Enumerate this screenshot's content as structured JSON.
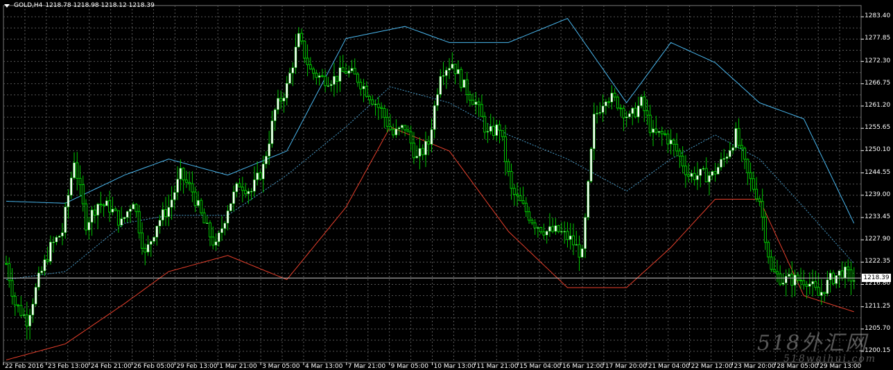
{
  "header": {
    "symbol": "GOLD,H4",
    "ohlc": "1218.78 1218.98 1218.12 1218.39"
  },
  "current_price": "1218.39",
  "price_axis": [
    "1283.40",
    "1277.85",
    "1272.30",
    "1266.75",
    "1261.20",
    "1255.65",
    "1250.10",
    "1244.55",
    "1239.00",
    "1233.45",
    "1227.90",
    "1222.35",
    "1216.80",
    "1211.25",
    "1205.70",
    "1200.15"
  ],
  "time_axis": [
    "22 Feb 2016",
    "23 Feb 13:00",
    "24 Feb 21:00",
    "26 Feb 05:00",
    "29 Feb 13:00",
    "1 Mar 21:00",
    "3 Mar 05:00",
    "4 Mar 13:00",
    "7 Mar 21:00",
    "9 Mar 05:00",
    "10 Mar 13:00",
    "11 Mar 21:00",
    "15 Mar 04:00",
    "16 Mar 12:00",
    "17 Mar 20:00",
    "21 Mar 04:00",
    "22 Mar 12:00",
    "23 Mar 20:00",
    "28 Mar 05:00",
    "29 Mar 13:00"
  ],
  "watermark": {
    "line1": "518外汇网",
    "line2": "518waihui.com"
  },
  "colors": {
    "background": "#000000",
    "grid": "#5a5a5a",
    "bull": "#ffffff",
    "wick": "#00c800",
    "upper_band": "#4ab8f0",
    "lower_band": "#e8402c",
    "middle_band": "#4aa0d0"
  },
  "chart_data": {
    "type": "candlestick",
    "ylim": [
      1197.4,
      1286.2
    ],
    "indicator": "Bollinger Bands",
    "close_anchors": [
      [
        0,
        1222
      ],
      [
        3,
        1212
      ],
      [
        7,
        1208
      ],
      [
        11,
        1218
      ],
      [
        15,
        1226
      ],
      [
        19,
        1230
      ],
      [
        23,
        1248
      ],
      [
        27,
        1232
      ],
      [
        31,
        1237
      ],
      [
        35,
        1236
      ],
      [
        39,
        1232
      ],
      [
        43,
        1238
      ],
      [
        47,
        1224
      ],
      [
        51,
        1232
      ],
      [
        55,
        1236
      ],
      [
        59,
        1244
      ],
      [
        63,
        1240
      ],
      [
        67,
        1232
      ],
      [
        71,
        1226
      ],
      [
        75,
        1236
      ],
      [
        79,
        1242
      ],
      [
        83,
        1240
      ],
      [
        87,
        1246
      ],
      [
        91,
        1260
      ],
      [
        95,
        1266
      ],
      [
        99,
        1278
      ],
      [
        103,
        1270
      ],
      [
        107,
        1268
      ],
      [
        111,
        1268
      ],
      [
        115,
        1270
      ],
      [
        119,
        1268
      ],
      [
        123,
        1264
      ],
      [
        127,
        1260
      ],
      [
        131,
        1254
      ],
      [
        135,
        1256
      ],
      [
        139,
        1248
      ],
      [
        143,
        1252
      ],
      [
        147,
        1270
      ],
      [
        151,
        1272
      ],
      [
        155,
        1266
      ],
      [
        159,
        1262
      ],
      [
        163,
        1254
      ],
      [
        167,
        1256
      ],
      [
        171,
        1240
      ],
      [
        175,
        1236
      ],
      [
        179,
        1232
      ],
      [
        183,
        1230
      ],
      [
        187,
        1230
      ],
      [
        191,
        1228
      ],
      [
        195,
        1224
      ],
      [
        199,
        1258
      ],
      [
        203,
        1264
      ],
      [
        207,
        1262
      ],
      [
        211,
        1258
      ],
      [
        215,
        1262
      ],
      [
        219,
        1254
      ],
      [
        223,
        1254
      ],
      [
        227,
        1250
      ],
      [
        231,
        1244
      ],
      [
        235,
        1244
      ],
      [
        239,
        1244
      ],
      [
        243,
        1248
      ],
      [
        247,
        1254
      ],
      [
        251,
        1244
      ],
      [
        255,
        1238
      ],
      [
        259,
        1220
      ],
      [
        263,
        1218
      ],
      [
        267,
        1218
      ],
      [
        271,
        1218
      ],
      [
        275,
        1214
      ],
      [
        279,
        1218
      ],
      [
        283,
        1220
      ],
      [
        287,
        1218
      ]
    ],
    "upper_band": [
      [
        0,
        1237.5
      ],
      [
        20,
        1237
      ],
      [
        40,
        1244
      ],
      [
        55,
        1248
      ],
      [
        75,
        1244
      ],
      [
        95,
        1250
      ],
      [
        115,
        1278
      ],
      [
        135,
        1281
      ],
      [
        150,
        1277
      ],
      [
        170,
        1277
      ],
      [
        190,
        1283
      ],
      [
        210,
        1262
      ],
      [
        225,
        1277
      ],
      [
        240,
        1272
      ],
      [
        255,
        1262
      ],
      [
        270,
        1258
      ],
      [
        287,
        1232
      ]
    ],
    "lower_band": [
      [
        0,
        1198
      ],
      [
        20,
        1202
      ],
      [
        40,
        1212
      ],
      [
        55,
        1220
      ],
      [
        75,
        1224
      ],
      [
        95,
        1218
      ],
      [
        115,
        1236
      ],
      [
        130,
        1256
      ],
      [
        150,
        1250
      ],
      [
        170,
        1230
      ],
      [
        190,
        1216
      ],
      [
        210,
        1216
      ],
      [
        225,
        1226
      ],
      [
        240,
        1238
      ],
      [
        255,
        1238
      ],
      [
        270,
        1214
      ],
      [
        287,
        1210
      ]
    ],
    "middle_band": [
      [
        0,
        1218
      ],
      [
        20,
        1220
      ],
      [
        40,
        1232
      ],
      [
        55,
        1234
      ],
      [
        75,
        1234
      ],
      [
        95,
        1244
      ],
      [
        115,
        1256
      ],
      [
        130,
        1266
      ],
      [
        150,
        1262
      ],
      [
        170,
        1254
      ],
      [
        190,
        1248
      ],
      [
        210,
        1240
      ],
      [
        225,
        1248
      ],
      [
        240,
        1254
      ],
      [
        255,
        1248
      ],
      [
        270,
        1236
      ],
      [
        287,
        1222
      ]
    ]
  }
}
